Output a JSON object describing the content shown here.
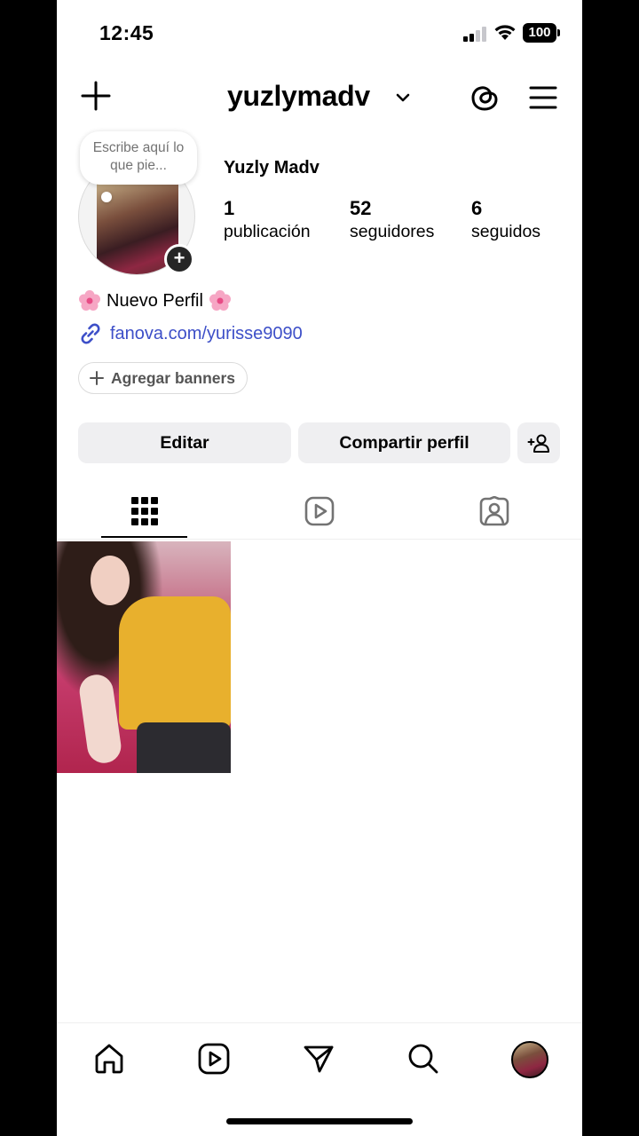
{
  "status_bar": {
    "time": "12:45",
    "battery": "100",
    "icons": [
      "signal-icon",
      "wifi-icon",
      "battery-icon"
    ]
  },
  "header": {
    "username": "yuzlymadv",
    "icons": [
      "plus-icon",
      "chevron-down-icon",
      "threads-icon",
      "menu-icon"
    ]
  },
  "profile": {
    "note_placeholder": "Escribe aquí lo que pie...",
    "full_name": "Yuzly Madv",
    "stats": [
      {
        "value": "1",
        "label": "publicación"
      },
      {
        "value": "52",
        "label": "seguidores"
      },
      {
        "value": "6",
        "label": "seguidos"
      }
    ],
    "bio": "Nuevo Perfil",
    "bio_emoji": "flower-icon",
    "link": "fanova.com/yurisse9090",
    "add_banners": "Agregar banners"
  },
  "actions": {
    "edit": "Editar",
    "share": "Compartir perfil"
  },
  "tabs": [
    "grid-icon",
    "reels-icon",
    "tagged-icon"
  ],
  "bottom_nav": [
    "home-icon",
    "reels-icon",
    "direct-icon",
    "search-icon",
    "profile-avatar"
  ],
  "colors": {
    "link": "#3d4fc8",
    "button_bg": "#efeff1",
    "note_text": "#737373"
  }
}
